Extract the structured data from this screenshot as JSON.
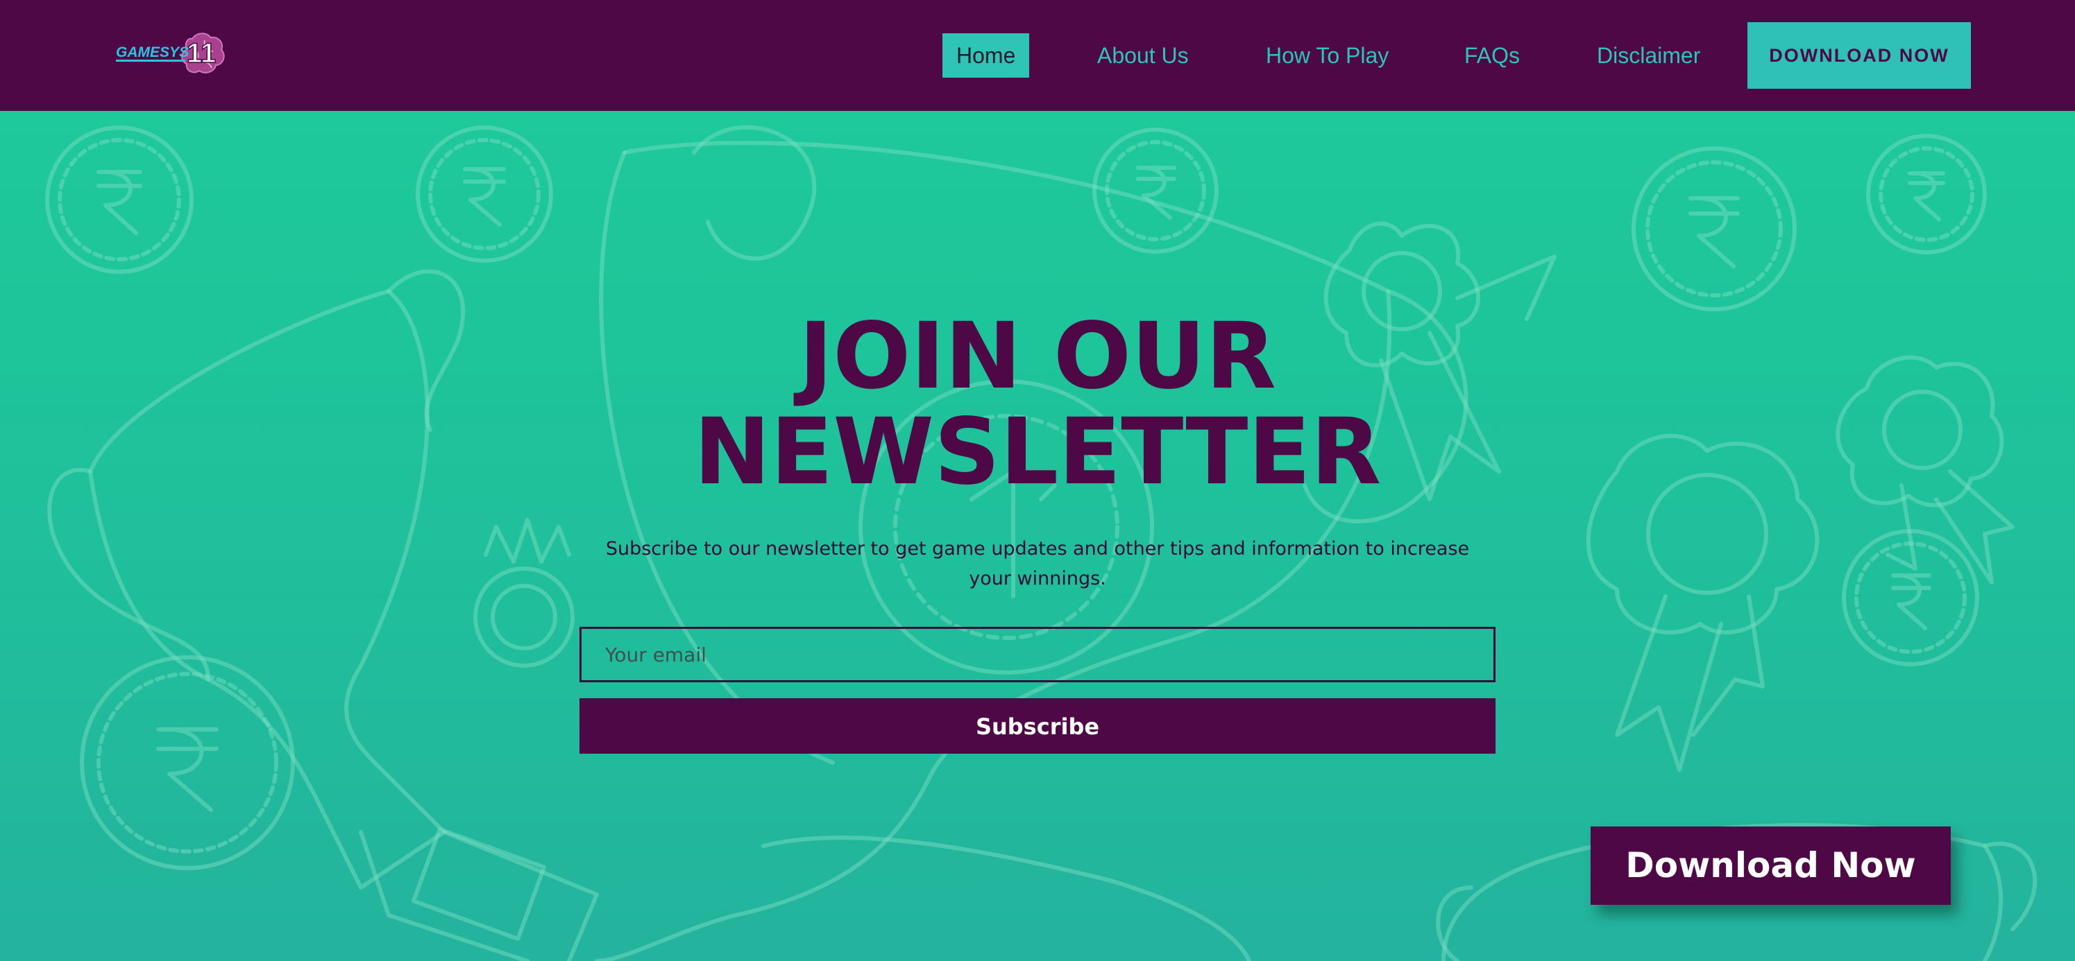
{
  "header": {
    "logo_text": "GAMESYS",
    "logo_number": "11",
    "nav": [
      {
        "label": "Home",
        "active": true
      },
      {
        "label": "About Us",
        "active": false
      },
      {
        "label": "How To Play",
        "active": false
      },
      {
        "label": "FAQs",
        "active": false
      },
      {
        "label": "Disclaimer",
        "active": false
      }
    ],
    "cta_label": "DOWNLOAD NOW"
  },
  "hero": {
    "headline_line1": "JOIN OUR",
    "headline_line2": "NEWSLETTER",
    "subtext": "Subscribe to our newsletter to get game updates and other tips and information to increase your winnings.",
    "email_placeholder": "Your email",
    "subscribe_label": "Subscribe",
    "floating_cta_label": "Download Now",
    "background_icons": [
      "rupee-coin-icon",
      "trophy-icon",
      "award-ribbon-icon"
    ]
  },
  "colors": {
    "brand_purple": "#4e0845",
    "teal_accent": "#2ec4b6",
    "hero_green": "#1fc39b"
  }
}
